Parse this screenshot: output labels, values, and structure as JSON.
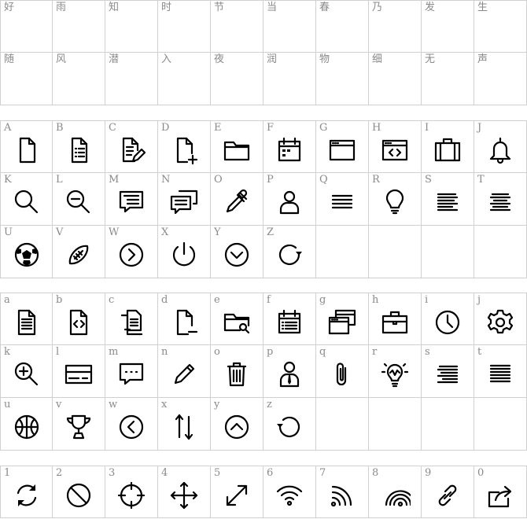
{
  "chinese": {
    "labels": [
      "好",
      "雨",
      "知",
      "时",
      "节",
      "当",
      "春",
      "乃",
      "发",
      "生",
      "随",
      "风",
      "潜",
      "入",
      "夜",
      "润",
      "物",
      "细",
      "无",
      "声"
    ],
    "glyph": ""
  },
  "upper": {
    "labels": [
      "A",
      "B",
      "C",
      "D",
      "E",
      "F",
      "G",
      "H",
      "I",
      "J",
      "K",
      "L",
      "M",
      "N",
      "O",
      "P",
      "Q",
      "R",
      "S",
      "T",
      "U",
      "V",
      "W",
      "X",
      "Y",
      "Z",
      "",
      "",
      "",
      ""
    ],
    "icons": [
      "document-icon",
      "document-list-icon",
      "document-edit-icon",
      "document-add-icon",
      "folder-icon",
      "calendar-icon",
      "browser-window-icon",
      "code-window-icon",
      "briefcase-icon",
      "bell-icon",
      "search-icon",
      "zoom-out-icon",
      "message-icon",
      "messages-icon",
      "eyedropper-icon",
      "user-icon",
      "menu-icon",
      "lightbulb-icon",
      "align-left-icon",
      "align-center-icon",
      "soccer-ball-icon",
      "football-icon",
      "chevron-right-circle-icon",
      "power-icon",
      "chevron-down-circle-icon",
      "redo-icon",
      "",
      "",
      "",
      ""
    ]
  },
  "lower": {
    "labels": [
      "a",
      "b",
      "c",
      "d",
      "e",
      "f",
      "g",
      "h",
      "i",
      "j",
      "k",
      "l",
      "m",
      "n",
      "o",
      "p",
      "q",
      "r",
      "s",
      "t",
      "u",
      "v",
      "w",
      "x",
      "y",
      "z",
      "",
      "",
      "",
      ""
    ],
    "icons": [
      "document-text-icon",
      "code-file-icon",
      "documents-icon",
      "document-remove-icon",
      "folder-search-icon",
      "calendar-list-icon",
      "windows-icon",
      "toolbox-icon",
      "clock-icon",
      "gear-icon",
      "zoom-in-icon",
      "credit-card-icon",
      "chat-dots-icon",
      "pencil-icon",
      "trash-icon",
      "businessman-icon",
      "paperclip-icon",
      "idea-icon",
      "align-right-icon",
      "justify-icon",
      "basketball-icon",
      "trophy-icon",
      "chevron-left-circle-icon",
      "sort-vertical-icon",
      "chevron-up-circle-icon",
      "undo-icon",
      "",
      "",
      "",
      ""
    ]
  },
  "digits": {
    "labels": [
      "1",
      "2",
      "3",
      "4",
      "5",
      "6",
      "7",
      "8",
      "9",
      "0"
    ],
    "icons": [
      "refresh-icon",
      "ban-icon",
      "crosshair-icon",
      "move-icon",
      "resize-diagonal-icon",
      "wifi-icon",
      "signal-icon",
      "broadcast-icon",
      "link-icon",
      "share-icon"
    ]
  }
}
